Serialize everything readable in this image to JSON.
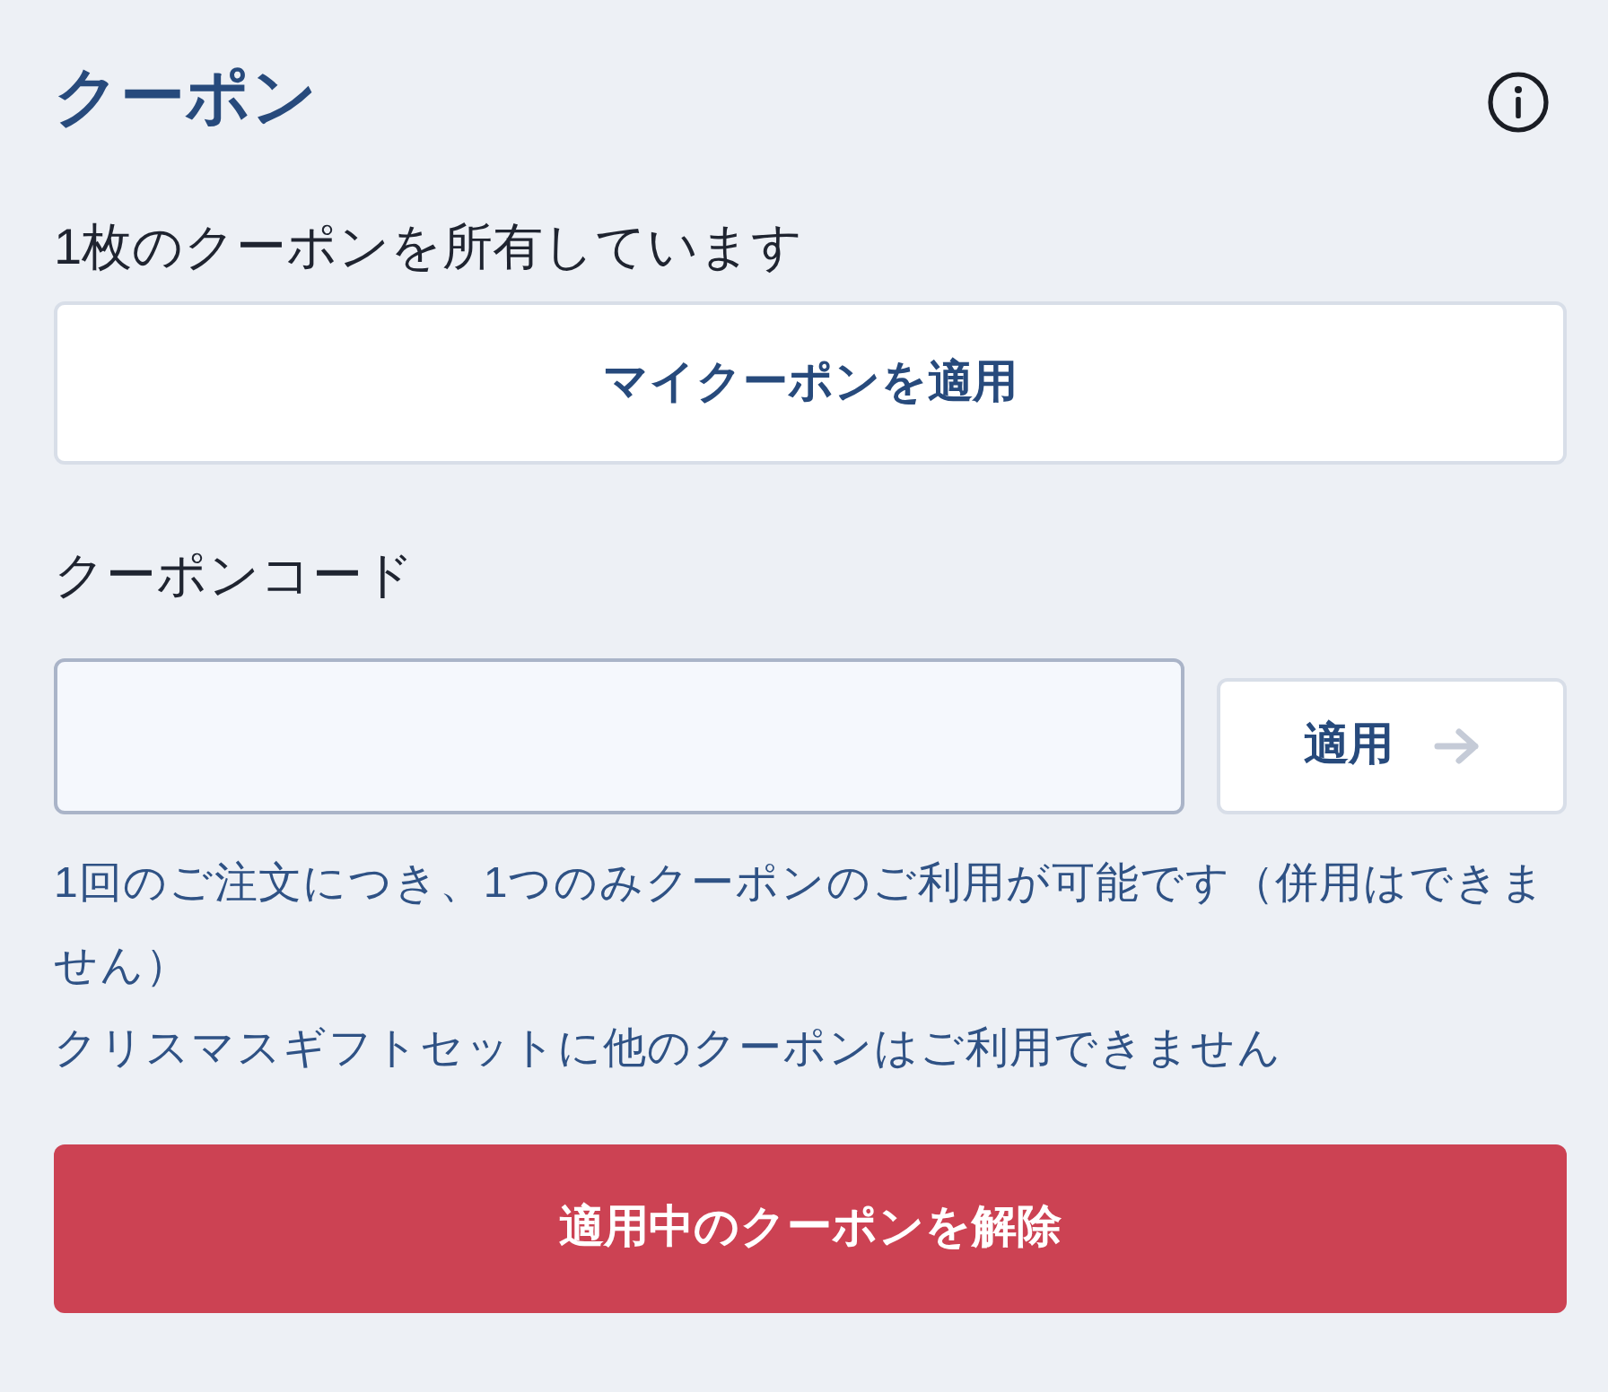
{
  "title": "クーポン",
  "owned_text": "1枚のクーポンを所有しています",
  "my_coupon_button": "マイクーポンを適用",
  "code_field": {
    "label": "クーポンコード"
  },
  "apply_button": "適用",
  "notes": [
    "1回のご注文につき、1つのみクーポンのご利用が可能です（併用はできません）",
    "クリスマスギフトセットに他のクーポンはご利用できません"
  ],
  "remove_button": "適用中のクーポンを解除"
}
